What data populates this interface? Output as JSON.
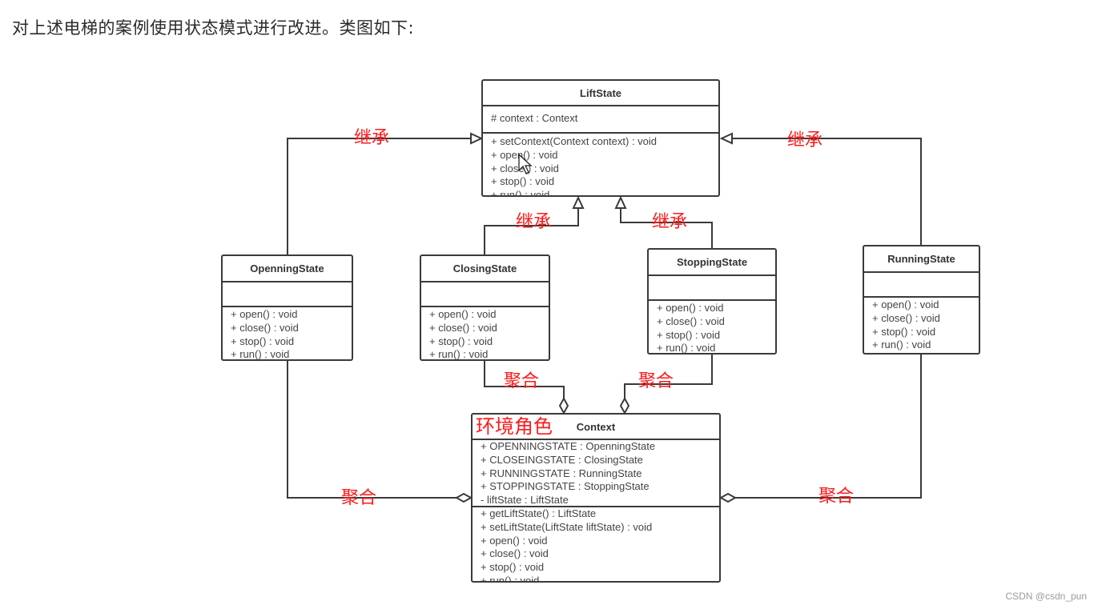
{
  "intro_text": "对上述电梯的案例使用状态模式进行改进。类图如下:",
  "watermark": "CSDN @csdn_pun",
  "colors": {
    "annotation": "#ff1a1a",
    "line": "#3a3a3a",
    "text": "#444444"
  },
  "classes": {
    "lift_state": {
      "name": "LiftState",
      "attributes": [
        "# context : Context"
      ],
      "operations": [
        "+ setContext(Context context) : void",
        "+ open() : void",
        "+ close() : void",
        "+ stop() : void",
        "+ run() : void"
      ]
    },
    "openning_state": {
      "name": "OpenningState",
      "attributes": [],
      "operations": [
        "+ open() : void",
        "+ close() : void",
        "+ stop() : void",
        "+ run() : void"
      ]
    },
    "closing_state": {
      "name": "ClosingState",
      "attributes": [],
      "operations": [
        "+ open() : void",
        "+ close() : void",
        "+ stop() : void",
        "+ run() : void"
      ]
    },
    "stopping_state": {
      "name": "StoppingState",
      "attributes": [],
      "operations": [
        "+ open() : void",
        "+ close() : void",
        "+ stop() : void",
        "+ run() : void"
      ]
    },
    "running_state": {
      "name": "RunningState",
      "attributes": [],
      "operations": [
        "+ open() : void",
        "+ close() : void",
        "+ stop() : void",
        "+ run() : void"
      ]
    },
    "context": {
      "name": "Context",
      "attributes": [
        "+ OPENNINGSTATE : OpenningState",
        "+ CLOSEINGSTATE : ClosingState",
        "+ RUNNINGSTATE : RunningState",
        "+ STOPPINGSTATE : StoppingState",
        "- liftState : LiftState"
      ],
      "operations": [
        "+ getLiftState() : LiftState",
        "+ setLiftState(LiftState liftState) : void",
        "+ open() : void",
        "+ close() : void",
        "+ stop() : void",
        "+ run() : void"
      ]
    }
  },
  "annotations": {
    "inherit_openning": "继承",
    "inherit_closing": "继承",
    "inherit_stopping": "继承",
    "inherit_running": "继承",
    "aggregate_openning": "聚合",
    "aggregate_closing": "聚合",
    "aggregate_stopping": "聚合",
    "aggregate_running": "聚合",
    "context_role": "环境角色"
  },
  "relations": [
    {
      "from": "OpenningState",
      "to": "LiftState",
      "type": "inheritance"
    },
    {
      "from": "ClosingState",
      "to": "LiftState",
      "type": "inheritance"
    },
    {
      "from": "StoppingState",
      "to": "LiftState",
      "type": "inheritance"
    },
    {
      "from": "RunningState",
      "to": "LiftState",
      "type": "inheritance"
    },
    {
      "from": "OpenningState",
      "to": "Context",
      "type": "aggregation"
    },
    {
      "from": "ClosingState",
      "to": "Context",
      "type": "aggregation"
    },
    {
      "from": "StoppingState",
      "to": "Context",
      "type": "aggregation"
    },
    {
      "from": "RunningState",
      "to": "Context",
      "type": "aggregation"
    }
  ]
}
